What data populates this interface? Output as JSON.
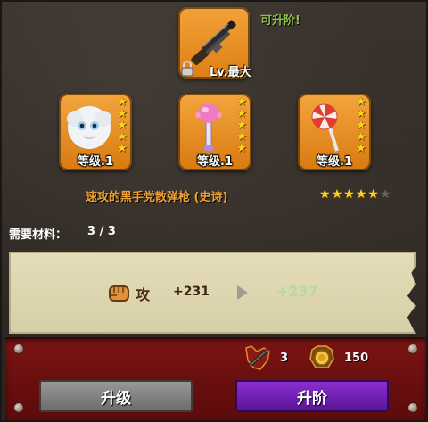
{
  "weapon": {
    "upgradable_text": "可升阶!",
    "level_text": "Lv.最大",
    "name": "速攻的黑手党散弹枪 (史诗)",
    "rating_on": 5,
    "rating_total": 6
  },
  "materials": [
    {
      "icon": "white-furball-icon",
      "level": "等级.1",
      "stars": 5
    },
    {
      "icon": "pink-mace-icon",
      "level": "等级.1",
      "stars": 5
    },
    {
      "icon": "lollipop-icon",
      "level": "等级.1",
      "stars": 5
    }
  ],
  "requirement": {
    "label": "需要材料：",
    "value": "3 / 3"
  },
  "stat": {
    "icon": "fist-icon",
    "name": "攻",
    "old": "+231",
    "new": "+237"
  },
  "costs": [
    {
      "icon": "shotgun-cost-icon",
      "value": "3"
    },
    {
      "icon": "gold-coin-icon",
      "value": "150"
    }
  ],
  "buttons": {
    "upgrade": "升级",
    "ascend": "升阶"
  },
  "colors": {
    "accent_orange": "#f0a030",
    "upgrade_green": "#8fbf4a",
    "ascend_purple": "#7b22c0",
    "bar_red": "#6a0f0f"
  }
}
